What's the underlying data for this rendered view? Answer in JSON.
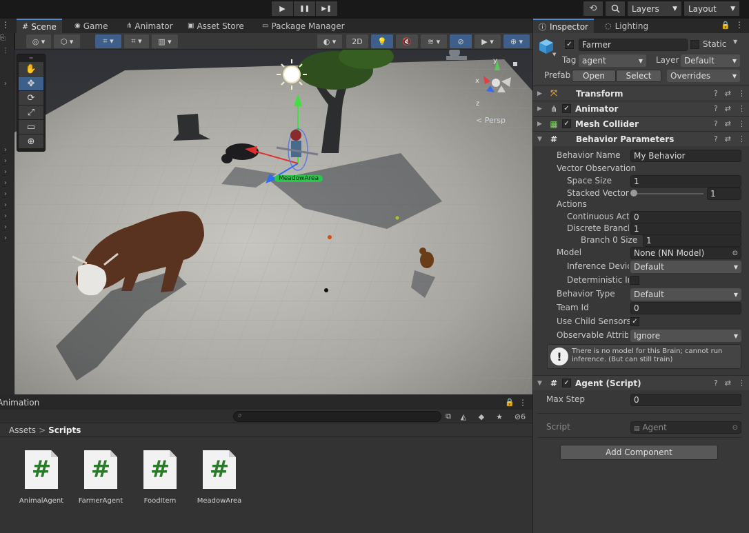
{
  "toolbar": {
    "play_glyph": "▶",
    "pause_glyph": "❚❚",
    "step_glyph": "▶❚",
    "history_glyph": "⟲",
    "search_glyph": "🔍",
    "layers_label": "Layers",
    "layout_label": "Layout"
  },
  "tabs": {
    "scene": "Scene",
    "game": "Game",
    "animator": "Animator",
    "asset_store": "Asset Store",
    "package_manager": "Package Manager"
  },
  "scene_toolbar": {
    "mode_2d": "2D"
  },
  "scene": {
    "persp_label": "< Persp",
    "gizmo_y": "y",
    "gizmo_x": "x",
    "gizmo_z": "z",
    "meadow_label": "MeadowArea"
  },
  "tools": [
    "✋",
    "✥",
    "⟳",
    "⤢",
    "▭",
    "⊕"
  ],
  "bottom_panel": {
    "title": "Animation",
    "search_placeholder": "",
    "hidden_count": "6",
    "breadcrumb_root": "Assets",
    "breadcrumb_sep": ">",
    "breadcrumb_current": "Scripts",
    "files": [
      {
        "icon": "#",
        "name": "AnimalAgent"
      },
      {
        "icon": "#",
        "name": "FarmerAgent"
      },
      {
        "icon": "#",
        "name": "FoodItem"
      },
      {
        "icon": "#",
        "name": "MeadowArea"
      }
    ]
  },
  "inspector": {
    "tab_inspector": "Inspector",
    "tab_lighting": "Lighting",
    "object_name": "Farmer",
    "static_label": "Static",
    "tag_label": "Tag",
    "tag_value": "agent",
    "layer_label": "Layer",
    "layer_value": "Default",
    "prefab_label": "Prefab",
    "open_button": "Open",
    "select_button": "Select",
    "overrides_label": "Overrides",
    "components": {
      "transform": "Transform",
      "animator": "Animator",
      "mesh_collider": "Mesh Collider",
      "behavior_parameters": "Behavior Parameters",
      "agent_script": "Agent (Script)"
    },
    "behavior": {
      "behavior_name_label": "Behavior Name",
      "behavior_name_value": "My Behavior",
      "vector_observation_label": "Vector Observation",
      "space_size_label": "Space Size",
      "space_size_value": "1",
      "stacked_vectors_label": "Stacked Vectors",
      "stacked_vectors_value": "1",
      "stacked_vectors_slider_fraction": 0,
      "actions_label": "Actions",
      "continuous_actions_label": "Continuous Actions",
      "continuous_actions_value": "0",
      "discrete_branches_label": "Discrete Branches",
      "discrete_branches_value": "1",
      "branch0_label": "Branch 0 Size",
      "branch0_value": "1",
      "model_label": "Model",
      "model_value": "None (NN Model)",
      "inference_device_label": "Inference Device",
      "inference_device_value": "Default",
      "deterministic_label": "Deterministic Inference",
      "behavior_type_label": "Behavior Type",
      "behavior_type_value": "Default",
      "team_id_label": "Team Id",
      "team_id_value": "0",
      "use_child_sensors_label": "Use Child Sensors",
      "observable_attr_label": "Observable Attribute Handling",
      "observable_attr_value": "Ignore",
      "help_text": "There is no model for this Brain; cannot run inference. (But can still train)"
    },
    "agent": {
      "max_step_label": "Max Step",
      "max_step_value": "0",
      "script_label": "Script",
      "script_value": "Agent"
    },
    "add_component": "Add Component"
  },
  "colors": {
    "accent": "#4b8bd7",
    "panel": "#383838",
    "dark": "#191919",
    "ground": "#b4b2ac",
    "script_green": "#2a7a2a"
  }
}
